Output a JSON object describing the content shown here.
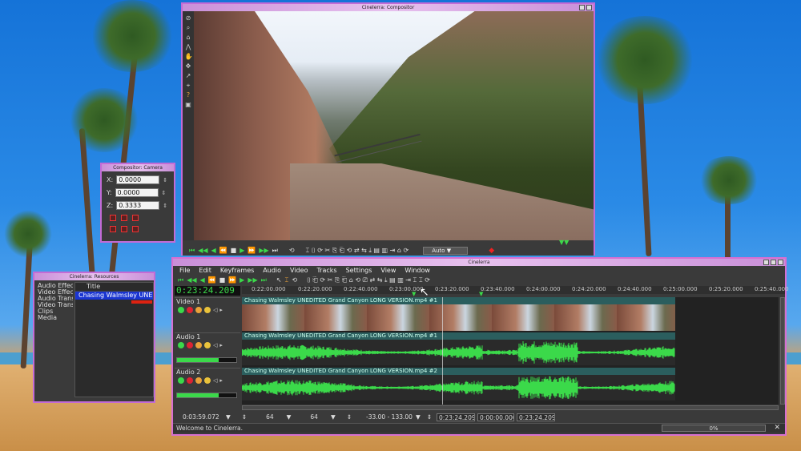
{
  "compositor": {
    "title": "Cinelerra: Compositor",
    "tools": [
      "⊘",
      "⌕",
      "⌂",
      "⋀",
      "✋",
      "✥",
      "↗",
      "⌖",
      "?",
      "▣"
    ],
    "zoom_value": "Auto",
    "zoom_arrow": "▼",
    "transport_icons": [
      "⏮",
      "◀◀",
      "◀",
      "⏪",
      "■",
      "▶",
      "⏩",
      "▶▶",
      "⏭"
    ]
  },
  "cameras": {
    "title": "Compositor: Camera",
    "x_label": "X:",
    "x_value": "0.0000",
    "y_label": "Y:",
    "y_value": "0.0000",
    "z_label": "Z:",
    "z_value": "0.3333"
  },
  "resources": {
    "title": "Cinelerra: Resources",
    "folders": [
      "Audio Effects",
      "Video Effects",
      "Audio Transitions",
      "Video Transitions",
      "Clips",
      "Media"
    ],
    "list_header": "Title",
    "selected_item": "Chasing Walmsley UNEDITED"
  },
  "main": {
    "title": "Cinelerra",
    "menu": [
      "File",
      "Edit",
      "Keyframes",
      "Audio",
      "Video",
      "Tracks",
      "Settings",
      "View",
      "Window"
    ],
    "clock": "0:23:24.209",
    "time_ticks": [
      "0:22:00.000",
      "0:22:20.000",
      "0:22:40.000",
      "0:23:00.000",
      "0:23:20.000",
      "0:23:40.000",
      "0:24:00.000",
      "0:24:20.000",
      "0:24:40.000",
      "0:25:00.000",
      "0:25:20.000",
      "0:25:40.000"
    ],
    "tracks": [
      {
        "name": "Video 1",
        "edit": "Chasing Walmsley UNEDITED   Grand Canyon   LONG VERSION.mp4 #1",
        "kind": "video"
      },
      {
        "name": "Audio 1",
        "edit": "Chasing Walmsley UNEDITED   Grand Canyon   LONG VERSION.mp4 #1",
        "kind": "audio"
      },
      {
        "name": "Audio 2",
        "edit": "Chasing Walmsley UNEDITED   Grand Canyon   LONG VERSION.mp4 #2",
        "kind": "audio"
      }
    ],
    "bottom": {
      "duration": "0:03:59.072",
      "zoom_samples": "64",
      "zoom_amp": "64",
      "zoom_db": "-33.00 - 133.00",
      "pos1": "0:23:24.209",
      "pos2": "0:00:00.000",
      "pos3": "0:23:24.209",
      "arrow": "▼",
      "spin": "⇕"
    },
    "status": "Welcome to Cinelerra.",
    "progress": "0%",
    "close": "✕"
  },
  "colors": {
    "accent_green": "#3bd94a",
    "window_border": "#c36bd6",
    "selection_blue": "#1a35d1"
  }
}
